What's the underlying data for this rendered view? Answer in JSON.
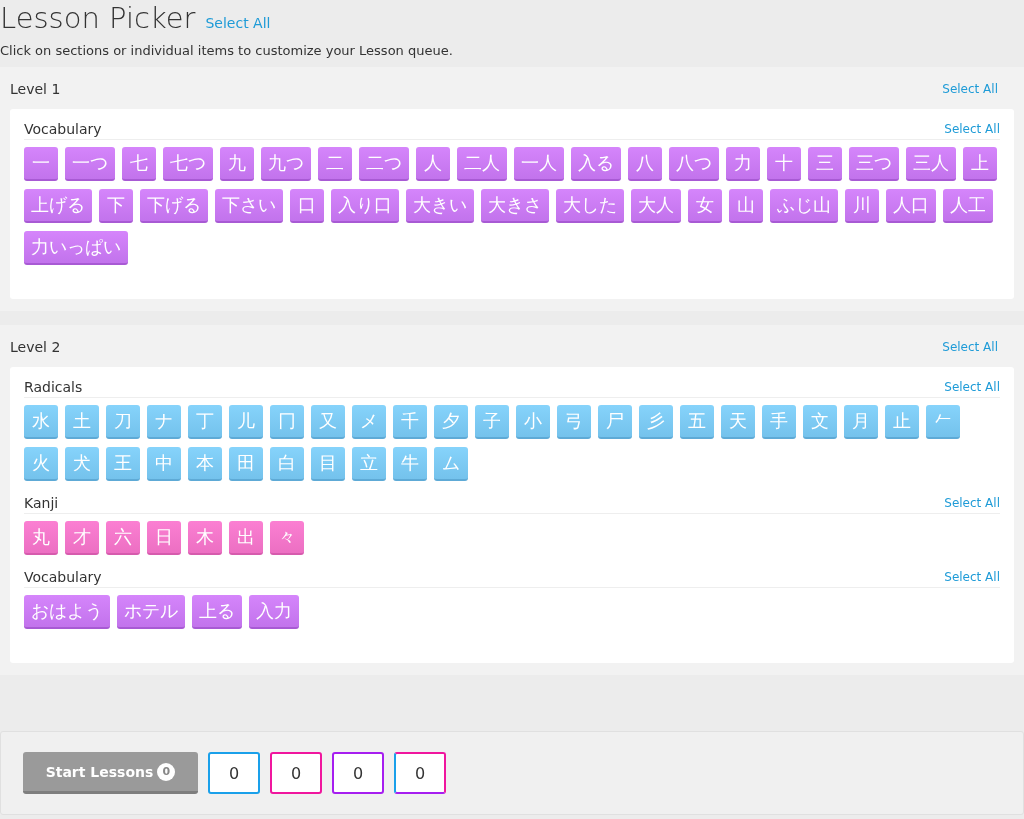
{
  "title": "Lesson Picker",
  "select_all": "Select All",
  "subtitle": "Click on sections or individual items to customize your Lesson queue.",
  "levels": [
    {
      "title": "Level 1",
      "select_all": "Select All",
      "groups": [
        {
          "title": "Vocabulary",
          "kind": "vocabulary",
          "select_all": "Select All",
          "items": [
            "一",
            "一つ",
            "七",
            "七つ",
            "九",
            "九つ",
            "二",
            "二つ",
            "人",
            "二人",
            "一人",
            "入る",
            "八",
            "八つ",
            "力",
            "十",
            "三",
            "三つ",
            "三人",
            "上",
            "上げる",
            "下",
            "下げる",
            "下さい",
            "口",
            "入り口",
            "大きい",
            "大きさ",
            "大した",
            "大人",
            "女",
            "山",
            "ふじ山",
            "川",
            "人口",
            "人工",
            "力いっぱい"
          ]
        }
      ]
    },
    {
      "title": "Level 2",
      "select_all": "Select All",
      "groups": [
        {
          "title": "Radicals",
          "kind": "radical",
          "select_all": "Select All",
          "items": [
            "水",
            "土",
            "刀",
            "ナ",
            "丁",
            "儿",
            "冂",
            "又",
            "メ",
            "千",
            "夕",
            "子",
            "小",
            "弓",
            "尸",
            "彡",
            "五",
            "天",
            "手",
            "文",
            "月",
            "止",
            "𠂉",
            "火",
            "犬",
            "王",
            "中",
            "本",
            "田",
            "白",
            "目",
            "立",
            "牛",
            "ム"
          ]
        },
        {
          "title": "Kanji",
          "kind": "kanji",
          "select_all": "Select All",
          "items": [
            "丸",
            "才",
            "六",
            "日",
            "木",
            "出",
            "々"
          ]
        },
        {
          "title": "Vocabulary",
          "kind": "vocabulary",
          "select_all": "Select All",
          "items": [
            "おはよう",
            "ホテル",
            "上る",
            "入力"
          ]
        }
      ]
    }
  ],
  "footer": {
    "start_button": "Start Lessons",
    "start_count": "0",
    "counters": [
      {
        "kind": "radical",
        "value": "0"
      },
      {
        "kind": "kanji",
        "value": "0"
      },
      {
        "kind": "vocabulary",
        "value": "0"
      },
      {
        "kind": "mixed",
        "value": "0"
      }
    ]
  }
}
